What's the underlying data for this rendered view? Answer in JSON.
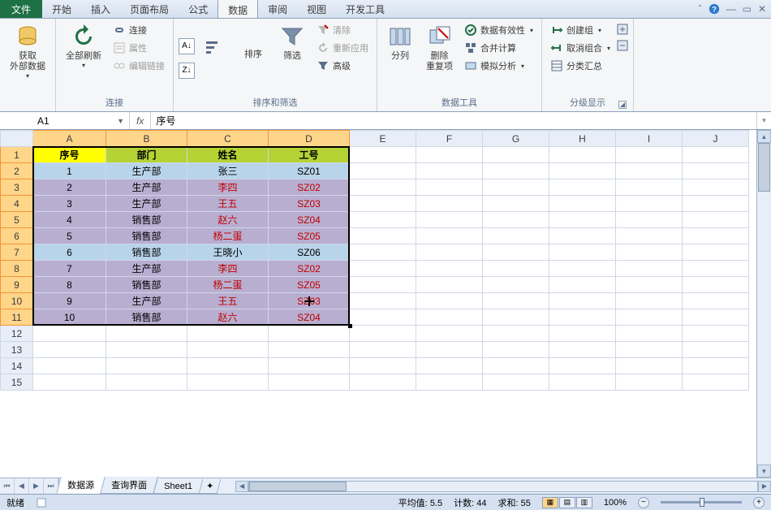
{
  "menu": {
    "file": "文件",
    "tabs": [
      "开始",
      "插入",
      "页面布局",
      "公式",
      "数据",
      "审阅",
      "视图",
      "开发工具"
    ],
    "active_index": 4
  },
  "ribbon": {
    "groups": {
      "get_data": {
        "label": "获取\n外部数据"
      },
      "connections": {
        "title": "连接",
        "refresh_all": "全部刷新",
        "conn": "连接",
        "props": "属性",
        "edit_links": "编辑链接"
      },
      "sort_filter": {
        "title": "排序和筛选",
        "sort": "排序",
        "filter": "筛选",
        "clear": "清除",
        "reapply": "重新应用",
        "advanced": "高级"
      },
      "data_tools": {
        "title": "数据工具",
        "text_to_cols": "分列",
        "remove_dup": "删除\n重复项",
        "validation": "数据有效性",
        "consolidate": "合并计算",
        "whatif": "模拟分析"
      },
      "outline": {
        "title": "分级显示",
        "group": "创建组",
        "ungroup": "取消组合",
        "subtotal": "分类汇总"
      }
    }
  },
  "namebox": "A1",
  "formula": "序号",
  "columns": [
    "A",
    "B",
    "C",
    "D",
    "E",
    "F",
    "G",
    "H",
    "I",
    "J"
  ],
  "sel_cols": 4,
  "sel_rows": 11,
  "headers": {
    "seq": "序号",
    "dept": "部门",
    "name": "姓名",
    "id": "工号"
  },
  "rows": [
    {
      "seq": "1",
      "dept": "生产部",
      "name": "张三",
      "id": "SZ01",
      "red": false,
      "bg": "blue"
    },
    {
      "seq": "2",
      "dept": "生产部",
      "name": "李四",
      "id": "SZ02",
      "red": true,
      "bg": "purple"
    },
    {
      "seq": "3",
      "dept": "生产部",
      "name": "王五",
      "id": "SZ03",
      "red": true,
      "bg": "purple"
    },
    {
      "seq": "4",
      "dept": "销售部",
      "name": "赵六",
      "id": "SZ04",
      "red": true,
      "bg": "purple"
    },
    {
      "seq": "5",
      "dept": "销售部",
      "name": "杨二蛋",
      "id": "SZ05",
      "red": true,
      "bg": "purple"
    },
    {
      "seq": "6",
      "dept": "销售部",
      "name": "王晓小",
      "id": "SZ06",
      "red": false,
      "bg": "blue"
    },
    {
      "seq": "7",
      "dept": "生产部",
      "name": "李四",
      "id": "SZ02",
      "red": true,
      "bg": "purple"
    },
    {
      "seq": "8",
      "dept": "销售部",
      "name": "杨二蛋",
      "id": "SZ05",
      "red": true,
      "bg": "purple"
    },
    {
      "seq": "9",
      "dept": "生产部",
      "name": "王五",
      "id": "SZ03",
      "red": true,
      "bg": "purple"
    },
    {
      "seq": "10",
      "dept": "销售部",
      "name": "赵六",
      "id": "SZ04",
      "red": true,
      "bg": "purple"
    }
  ],
  "empty_rows": [
    12,
    13,
    14,
    15
  ],
  "sheets": [
    "数据源",
    "查询界面",
    "Sheet1"
  ],
  "active_sheet": 0,
  "status": {
    "ready": "就绪",
    "avg_label": "平均值:",
    "avg": "5.5",
    "count_label": "计数:",
    "count": "44",
    "sum_label": "求和:",
    "sum": "55",
    "zoom": "100%"
  }
}
